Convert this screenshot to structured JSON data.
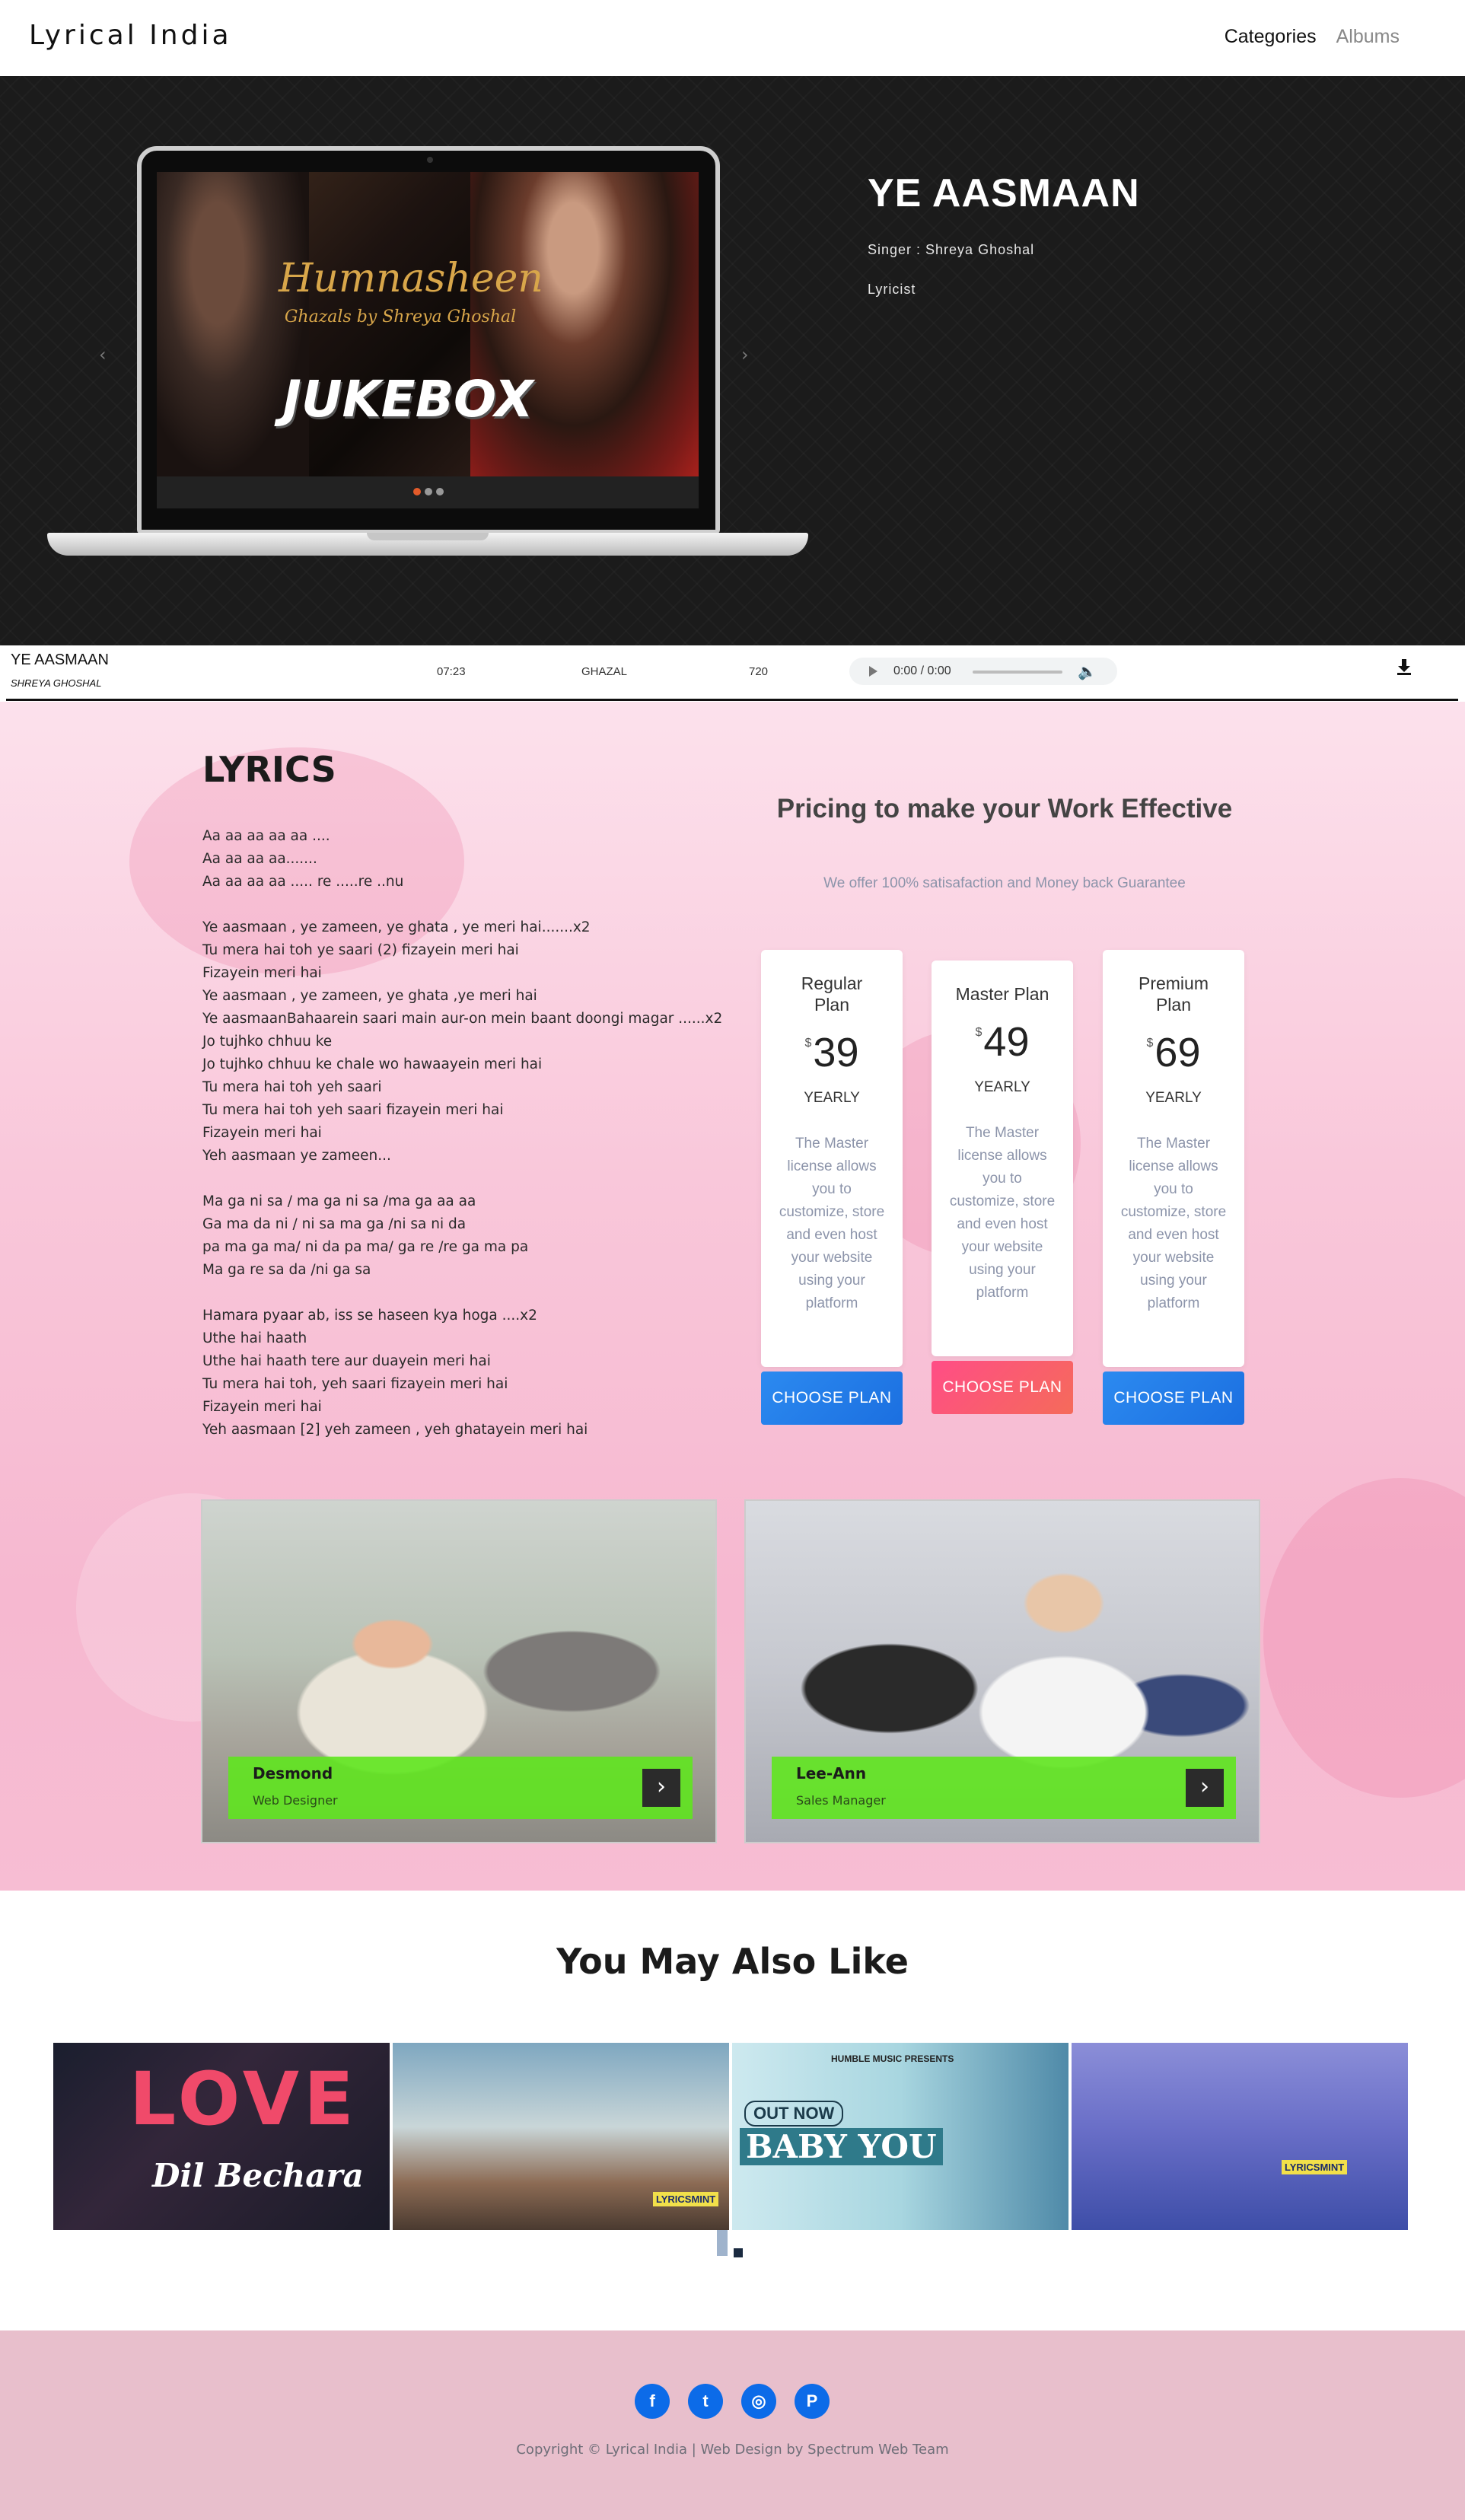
{
  "brand": "Lyrical India",
  "nav": {
    "categories": "Categories",
    "albums": "Albums"
  },
  "hero": {
    "screen_title": "Humnasheen",
    "screen_subtitle": "Ghazals by Shreya Ghoshal",
    "screen_jukebox": "JUKEBOX",
    "song_title": "YE AASMAAN",
    "singer": "Singer : Shreya Ghoshal",
    "lyricist": "Lyricist",
    "prev": "‹",
    "next": "›"
  },
  "player": {
    "title": "YE AASMAAN",
    "singer": "SHREYA GHOSHAL",
    "duration": "07:23",
    "genre": "GHAZAL",
    "year": "720",
    "time": "0:00 / 0:00",
    "icons": [
      "play-icon",
      "volume-icon",
      "download-icon"
    ]
  },
  "lyrics": {
    "title": "LYRICS",
    "lines": [
      "Aa aa aa aa aa ....",
      "Aa aa aa aa.......",
      "Aa aa aa aa .....   re .....re ..nu",
      "",
      "Ye aasmaan , ye zameen, ye ghata , ye meri hai.......x2",
      "Tu mera hai toh ye saari (2) fizayein meri hai",
      "Fizayein meri hai",
      "Ye aasmaan , ye zameen, ye ghata ,ye meri hai",
      "Ye aasmaanBahaarein saari main aur-on mein baant doongi magar ......x2",
      "Jo tujhko chhuu ke",
      "Jo tujhko chhuu ke chale wo hawaayein meri hai",
      "Tu mera hai toh yeh saari",
      "Tu mera hai toh yeh saari fizayein meri hai",
      "Fizayein meri hai",
      "Yeh aasmaan ye zameen...",
      "",
      "Ma ga ni sa / ma ga ni sa /ma ga aa aa",
      "Ga ma da ni / ni sa ma ga /ni sa ni da",
      "pa ma ga ma/ ni da pa ma/ ga re /re ga ma pa",
      "Ma ga re sa da /ni ga sa",
      "",
      "Hamara pyaar ab,  iss se haseen kya hoga ....x2",
      "Uthe hai haath",
      "Uthe hai haath tere aur duayein meri hai",
      "Tu mera hai toh, yeh saari fizayein meri hai",
      "Fizayein meri hai",
      "Yeh aasmaan [2] yeh zameen , yeh ghatayein meri hai"
    ]
  },
  "pricing": {
    "title": "Pricing to make your Work Effective",
    "subtitle": "We offer 100% satisafaction and Money back Guarantee",
    "plans": [
      {
        "name": "Regular Plan",
        "currency": "$",
        "price": "39",
        "period": "YEARLY",
        "desc": "The Master license allows you to customize, store and even host your website using your platform",
        "cta": "CHOOSE PLAN"
      },
      {
        "name": "Master Plan",
        "currency": "$",
        "price": "49",
        "period": "YEARLY",
        "desc": "The Master license allows you to customize, store and even host your website using your platform",
        "cta": "CHOOSE PLAN"
      },
      {
        "name": "Premium Plan",
        "currency": "$",
        "price": "69",
        "period": "YEARLY",
        "desc": "The Master license allows you to customize, store and even host your website using your platform",
        "cta": "CHOOSE PLAN"
      }
    ]
  },
  "team": [
    {
      "name": "Desmond",
      "role": "Web Designer"
    },
    {
      "name": "Lee-Ann",
      "role": "Sales Manager"
    }
  ],
  "also_like": {
    "title": "You May Also Like",
    "tiles": [
      {
        "title": "Dil Bechara",
        "word": "LOVE"
      },
      {
        "title": "",
        "word": "LYRICSMINT"
      },
      {
        "title": "BABY YOU",
        "badge": "OUT NOW",
        "presents": "HUMBLE MUSIC PRESENTS"
      },
      {
        "title": "",
        "word": "LYRICSMINT"
      }
    ]
  },
  "footer": {
    "socials": [
      "facebook-icon",
      "twitter-icon",
      "instagram-icon",
      "pinterest-icon"
    ],
    "copyright": "Copyright © Lyrical India | Web Design by Spectrum Web Team"
  },
  "colors": {
    "accent_blue": "#1b6fe0",
    "accent_pink": "#ff4d86",
    "banner_green": "#5fe61e",
    "pink_bg": "#f9c7da",
    "footer_bg": "#e8bfcc"
  }
}
